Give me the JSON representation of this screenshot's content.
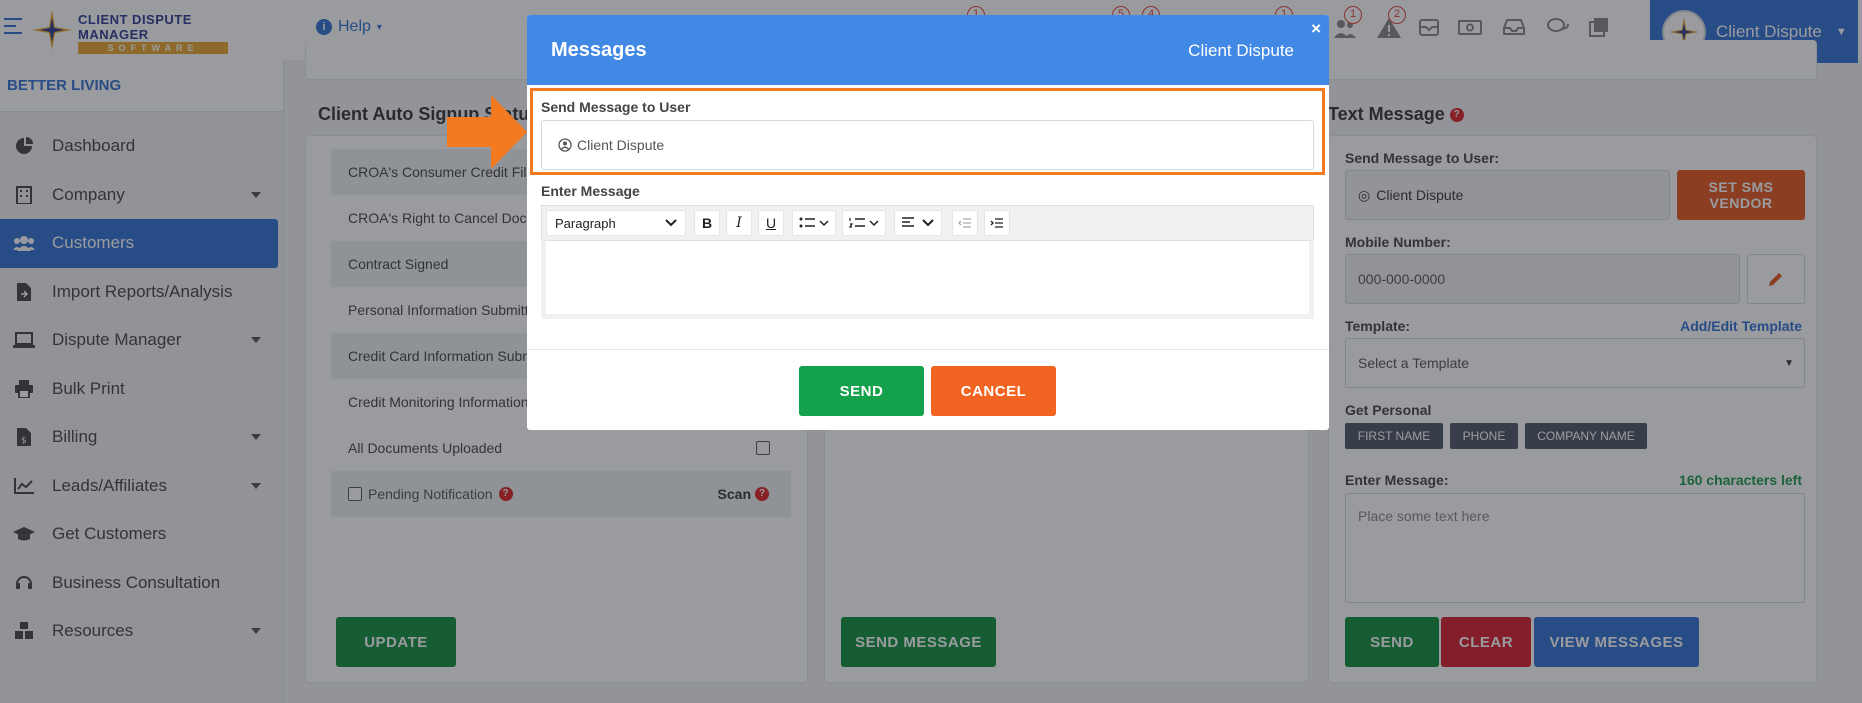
{
  "header": {
    "logo_line1": "CLIENT DISPUTE",
    "logo_line2": "MANAGER",
    "logo_line3": "SOFTWARE",
    "help_label": "Help",
    "user_name": "Client Dispute",
    "badges": [
      "1",
      "5",
      "4",
      "1",
      "1",
      "2"
    ]
  },
  "sidebar": {
    "company": "BETTER LIVING",
    "items": [
      {
        "label": "Dashboard",
        "icon": "pie-chart-icon"
      },
      {
        "label": "Company",
        "icon": "building-icon",
        "dropdown": true
      },
      {
        "label": "Customers",
        "icon": "users-icon",
        "active": true
      },
      {
        "label": "Import Reports/Analysis",
        "icon": "file-import-icon"
      },
      {
        "label": "Dispute Manager",
        "icon": "laptop-icon",
        "dropdown": true
      },
      {
        "label": "Bulk Print",
        "icon": "printer-icon"
      },
      {
        "label": "Billing",
        "icon": "invoice-icon",
        "dropdown": true
      },
      {
        "label": "Leads/Affiliates",
        "icon": "chart-line-icon",
        "dropdown": true
      },
      {
        "label": "Get Customers",
        "icon": "graduation-cap-icon"
      },
      {
        "label": "Business Consultation",
        "icon": "headset-icon"
      },
      {
        "label": "Resources",
        "icon": "boxes-icon",
        "dropdown": true
      }
    ]
  },
  "auto_sign": {
    "title": "Client Auto Signup Status",
    "rows": [
      "CROA's Consumer Credit File Rights",
      "CROA's Right to Cancel Document",
      "Contract Signed",
      "Personal Information Submitted",
      "Credit Card Information Submitted",
      "Credit Monitoring Information Submitted",
      "All Documents Uploaded"
    ],
    "pending_label": "Pending Notification",
    "scan_label": "Scan",
    "update_button": "UPDATE"
  },
  "middle": {
    "send_message_button": "SEND MESSAGE"
  },
  "text_message": {
    "title": "Text Message",
    "send_to_label": "Send Message to User:",
    "send_to_value": "Client Dispute",
    "sms_vendor_button": "SET SMS VENDOR",
    "mobile_label": "Mobile Number:",
    "mobile_placeholder": "000-000-0000",
    "template_label": "Template:",
    "template_link": "Add/Edit Template",
    "template_placeholder": "Select a Template",
    "personal_label": "Get Personal",
    "tags": [
      "FIRST NAME",
      "PHONE",
      "COMPANY NAME"
    ],
    "enter_label": "Enter Message:",
    "chars_left": "160 characters left",
    "message_placeholder": "Place some text here",
    "send_button": "SEND",
    "clear_button": "CLEAR",
    "view_button": "VIEW MESSAGES"
  },
  "modal": {
    "title": "Messages",
    "subtitle": "Client Dispute",
    "close": "×",
    "send_to_label": "Send Message to User",
    "send_to_value": "Client Dispute",
    "enter_label": "Enter Message",
    "paragraph": "Paragraph",
    "send_button": "SEND",
    "cancel_button": "CANCEL"
  },
  "colors": {
    "primary": "#2f6fd1",
    "modal_header": "#4289e6",
    "highlight": "#f47a20",
    "green": "#0f8f3d",
    "orange": "#e3561d",
    "red": "#d51d2a"
  }
}
